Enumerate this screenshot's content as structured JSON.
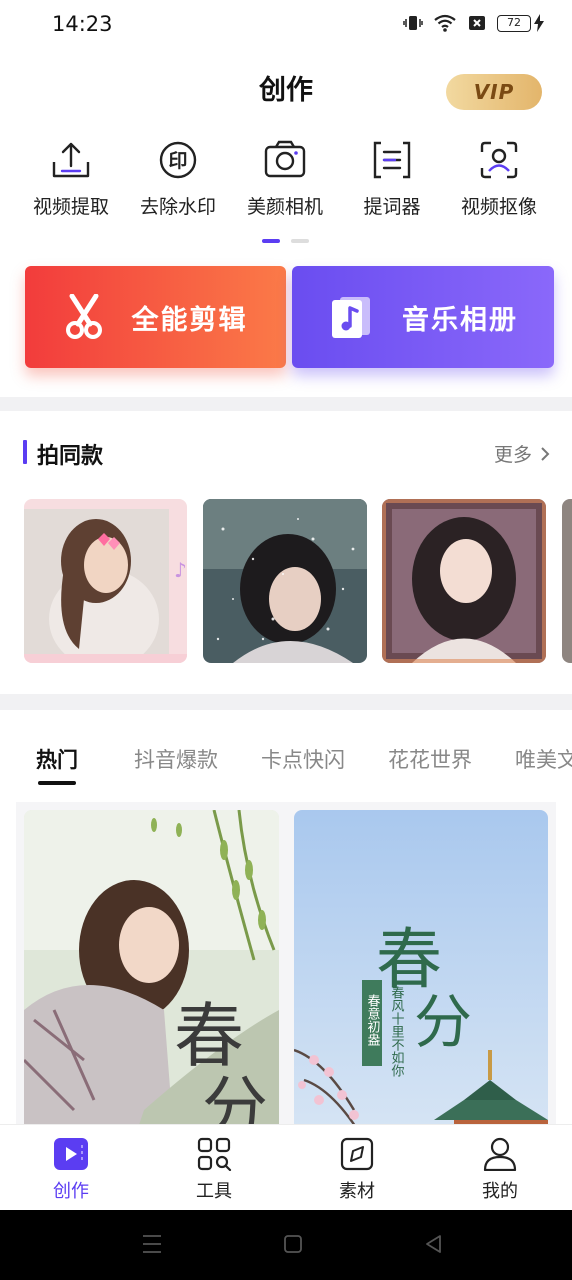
{
  "status": {
    "time": "14:23",
    "battery": "72"
  },
  "header": {
    "title": "创作",
    "vip": "VIP"
  },
  "tools": [
    {
      "label": "视频提取",
      "icon": "upload-tray-icon"
    },
    {
      "label": "去除水印",
      "icon": "stamp-icon"
    },
    {
      "label": "美颜相机",
      "icon": "camera-icon"
    },
    {
      "label": "提词器",
      "icon": "teleprompter-icon"
    },
    {
      "label": "视频抠像",
      "icon": "portrait-cutout-icon"
    }
  ],
  "actions": {
    "edit": "全能剪辑",
    "album": "音乐相册"
  },
  "section": {
    "title": "拍同款",
    "more": "更多"
  },
  "tabs": [
    "热门",
    "抖音爆款",
    "卡点快闪",
    "花花世界",
    "唯美文"
  ],
  "cards": [
    {
      "big": "春",
      "big2": "分"
    },
    {
      "big": "春",
      "big2": "分",
      "side1": "春意初盎",
      "side2": "春风十里不如你"
    }
  ],
  "nav": [
    {
      "label": "创作",
      "icon": "create-icon"
    },
    {
      "label": "工具",
      "icon": "tools-grid-icon"
    },
    {
      "label": "素材",
      "icon": "material-icon"
    },
    {
      "label": "我的",
      "icon": "profile-icon"
    }
  ],
  "colors": {
    "accent": "#5b3df2",
    "edit_start": "#f23c3c",
    "edit_end": "#fb7a48",
    "album_start": "#6a4df0",
    "album_end": "#8a68fa",
    "vip": "#e3b56b"
  }
}
